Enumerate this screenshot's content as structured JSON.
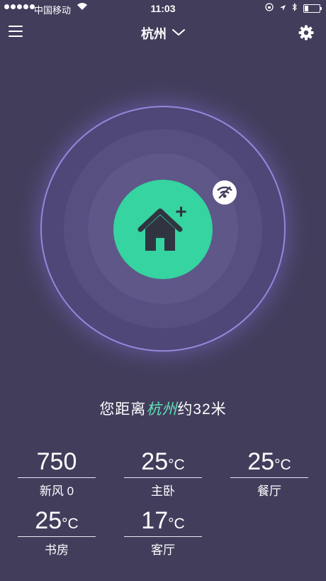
{
  "status_bar": {
    "carrier": "中国移动",
    "time": "11:03",
    "battery_level": 0.25
  },
  "nav": {
    "city": "杭州",
    "menu_icon": "hamburger-icon",
    "settings_icon": "gear-icon",
    "dropdown_icon": "chevron-down-icon"
  },
  "radar": {
    "home_icon": "home-add-icon",
    "wifi_icon": "wifi-off-icon",
    "accent_color": "#35d4a0"
  },
  "distance": {
    "prefix": "您距离",
    "city": "杭州",
    "suffix": "约32米"
  },
  "rooms": [
    {
      "value": "750",
      "unit": "",
      "name": "新风 0"
    },
    {
      "value": "25",
      "unit": "°C",
      "name": "主卧"
    },
    {
      "value": "25",
      "unit": "°C",
      "name": "餐厅"
    },
    {
      "value": "25",
      "unit": "°C",
      "name": "书房"
    },
    {
      "value": "17",
      "unit": "°C",
      "name": "客厅"
    }
  ]
}
